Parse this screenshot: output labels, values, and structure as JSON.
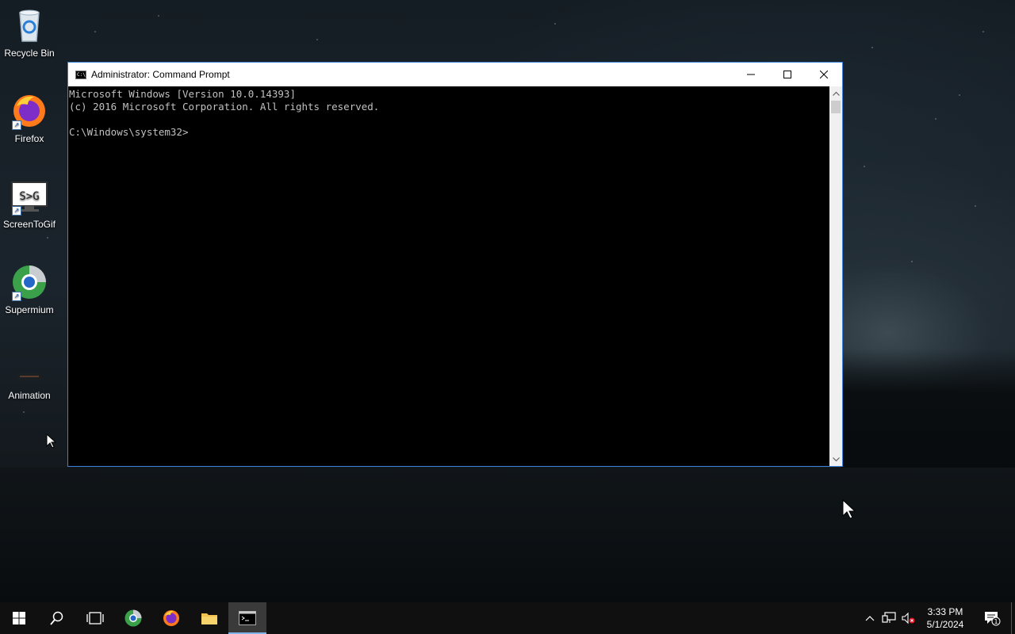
{
  "desktop": {
    "icons": [
      {
        "label": "Recycle Bin",
        "icon": "recycle-bin-icon"
      },
      {
        "label": "Firefox",
        "icon": "firefox-icon"
      },
      {
        "label": "ScreenToGif",
        "icon": "screentogif-icon"
      },
      {
        "label": "Supermium",
        "icon": "supermium-icon"
      },
      {
        "label": "Animation",
        "icon": "animation-file-icon"
      }
    ]
  },
  "window": {
    "title": "Administrator: Command Prompt",
    "console_lines": [
      "Microsoft Windows [Version 10.0.14393]",
      "(c) 2016 Microsoft Corporation. All rights reserved.",
      "",
      "C:\\Windows\\system32>"
    ],
    "accent_color": "#3b82d8"
  },
  "taskbar": {
    "apps": [
      {
        "name": "start",
        "icon": "windows-logo-icon"
      },
      {
        "name": "search",
        "icon": "search-icon"
      },
      {
        "name": "task-view",
        "icon": "task-view-icon"
      },
      {
        "name": "supermium",
        "icon": "supermium-icon"
      },
      {
        "name": "firefox",
        "icon": "firefox-icon"
      },
      {
        "name": "file-explorer",
        "icon": "folder-icon"
      },
      {
        "name": "command-prompt",
        "icon": "cmd-icon",
        "active": true
      }
    ],
    "clock": {
      "time": "3:33 PM",
      "date": "5/1/2024"
    },
    "notification_count": "1"
  }
}
